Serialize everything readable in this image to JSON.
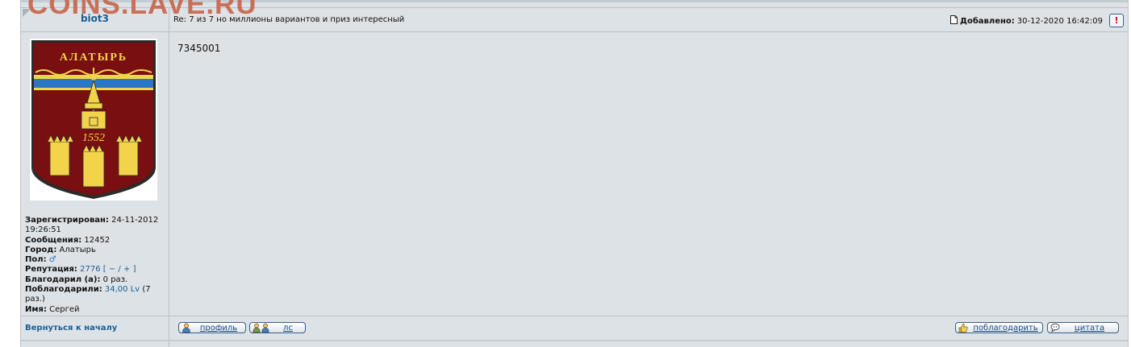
{
  "watermark": "COINS.LAVE.RU",
  "post": {
    "username": "biot3",
    "subject": "Re: 7 из 7 но миллионы вариантов и приз интересный",
    "added_label": "Добавлено:",
    "added_value": "30-12-2020 16:42:09",
    "report_icon_text": "!",
    "body": "7345001"
  },
  "avatar": {
    "title": "АЛАТЫРЬ",
    "year": "1552",
    "colors": {
      "field": "#7a0f12",
      "gold": "#f2d34a",
      "blue": "#2a76c7",
      "outline": "#2b2b2b"
    }
  },
  "userinfo": {
    "registered_label": "Зарегистрирован:",
    "registered_value": "24-11-2012 19:26:51",
    "messages_label": "Сообщения:",
    "messages_value": "12452",
    "city_label": "Город:",
    "city_value": "Алатырь",
    "gender_label": "Пол:",
    "gender_icon": "♂",
    "reputation_label": "Репутация:",
    "reputation_value": "2776",
    "reputation_bracket_open": "[",
    "reputation_minus": "−",
    "reputation_sep": "/",
    "reputation_plus": "+",
    "reputation_bracket_close": "]",
    "thanked_label": "Благодарил (а):",
    "thanked_value": "0 раз.",
    "was_thanked_label": "Поблагодарили:",
    "was_thanked_value": "34,00 Lv",
    "was_thanked_count": "(7 раз.)",
    "name_label": "Имя:",
    "name_value": "Сергей"
  },
  "footer": {
    "back_to_top": "Вернуться к началу",
    "profile_btn": "профиль",
    "pm_btn": "лс",
    "thank_btn": "поблагодарить",
    "quote_btn": "цитата"
  },
  "icons": {
    "post": "document-icon",
    "profile": "user-icon",
    "pm": "users-icon",
    "thank": "thumbs-up-icon",
    "quote": "speech-bubble-icon"
  }
}
